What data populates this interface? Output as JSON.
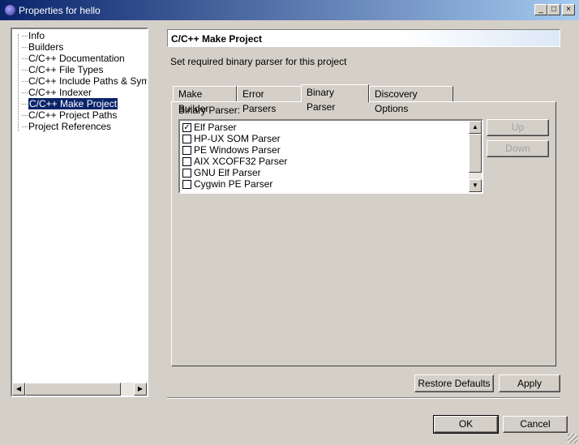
{
  "window": {
    "title": "Properties for hello"
  },
  "titlebar_buttons": {
    "minimize": "_",
    "maximize": "□",
    "close": "×"
  },
  "tree": {
    "items": [
      {
        "label": "Info"
      },
      {
        "label": "Builders"
      },
      {
        "label": "C/C++ Documentation"
      },
      {
        "label": "C/C++ File Types"
      },
      {
        "label": "C/C++ Include Paths & Symbols"
      },
      {
        "label": "C/C++ Indexer"
      },
      {
        "label": "C/C++ Make Project",
        "selected": true
      },
      {
        "label": "C/C++ Project Paths"
      },
      {
        "label": "Project References"
      }
    ]
  },
  "page": {
    "title": "C/C++ Make Project",
    "description": "Set required binary parser for this project"
  },
  "tabs": [
    {
      "label": "Make Builder"
    },
    {
      "label": "Error Parsers"
    },
    {
      "label": "Binary Parser",
      "active": true
    },
    {
      "label": "Discovery Options"
    }
  ],
  "binary_parser": {
    "group_label": "Binary Parser:",
    "parsers": [
      {
        "label": "Elf Parser",
        "checked": true
      },
      {
        "label": "HP-UX SOM Parser",
        "checked": false
      },
      {
        "label": "PE Windows Parser",
        "checked": false
      },
      {
        "label": "AIX XCOFF32 Parser",
        "checked": false
      },
      {
        "label": "GNU Elf Parser",
        "checked": false
      },
      {
        "label": "Cygwin PE Parser",
        "checked": false
      }
    ],
    "up_label": "Up",
    "down_label": "Down"
  },
  "buttons": {
    "restore_defaults": "Restore Defaults",
    "apply": "Apply",
    "ok": "OK",
    "cancel": "Cancel"
  },
  "colors": {
    "selection": "#0a246a",
    "titlebar_start": "#0a246a",
    "titlebar_end": "#a6caf0",
    "face": "#d4d0c8"
  },
  "icons": {
    "app": "eclipse-icon",
    "check": "✓"
  }
}
